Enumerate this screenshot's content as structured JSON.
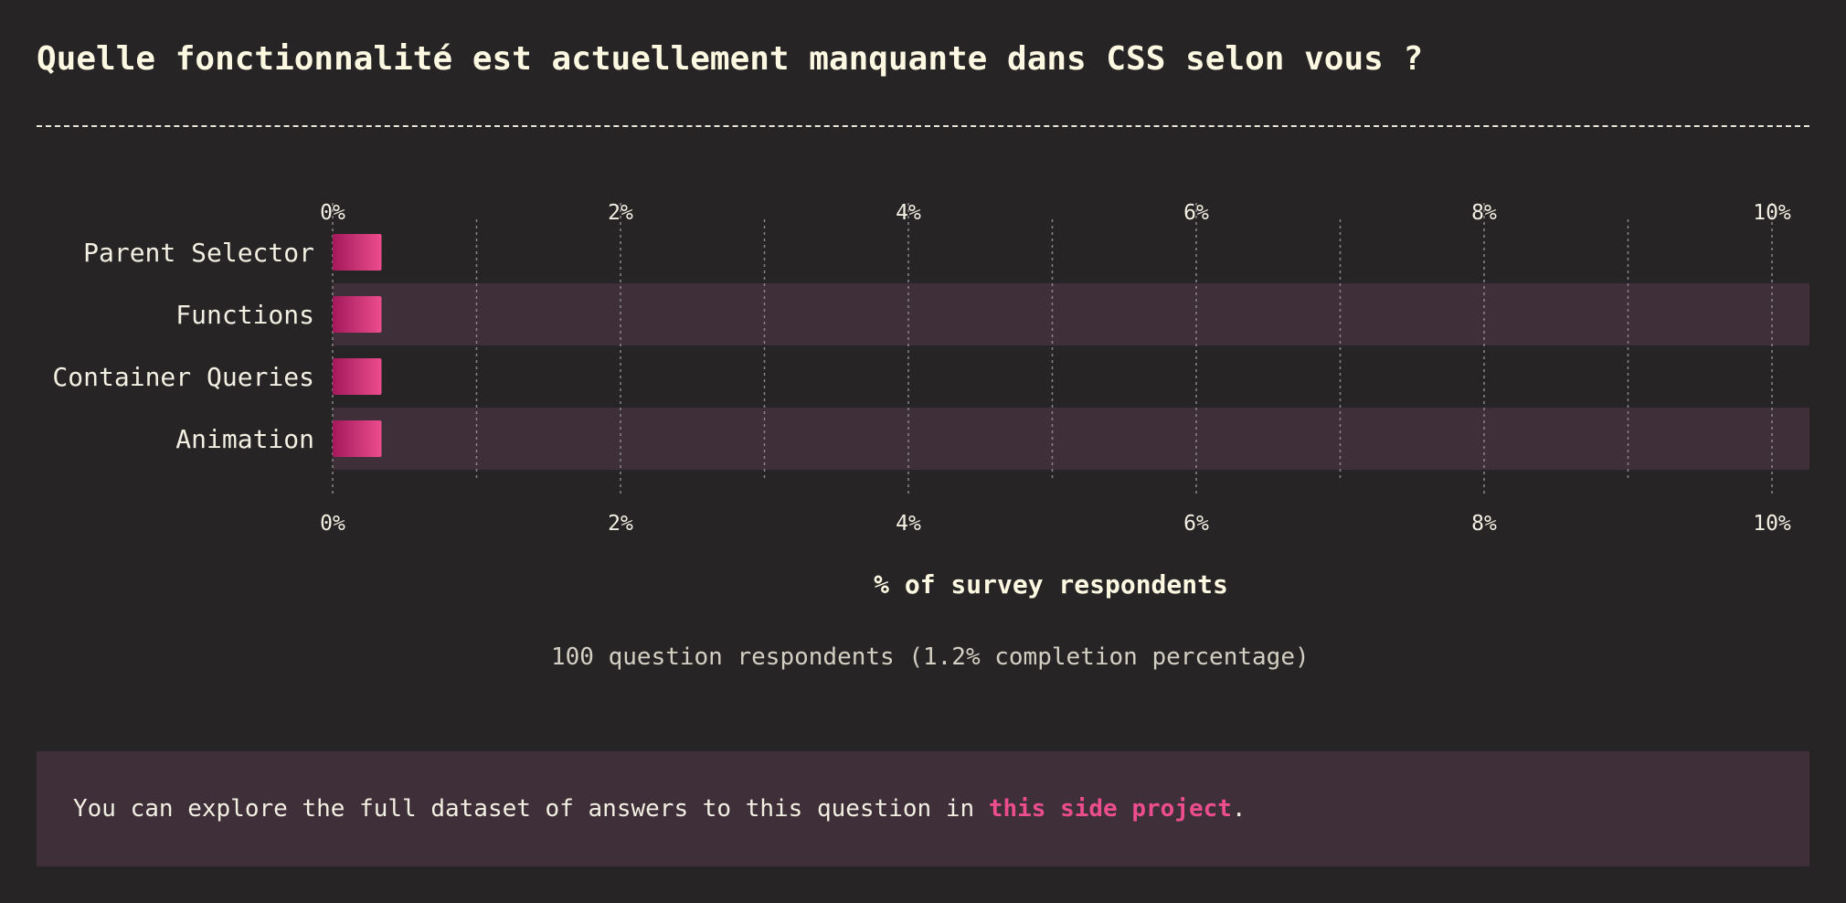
{
  "page": {
    "title": "Quelle fonctionnalité est actuellement manquante dans CSS selon vous ?"
  },
  "chart_data": {
    "type": "bar",
    "orientation": "horizontal",
    "categories": [
      "Parent Selector",
      "Functions",
      "Container Queries",
      "Animation"
    ],
    "values": [
      0.2,
      0.2,
      0.2,
      0.2
    ],
    "xlim": [
      0,
      10
    ],
    "xticks": [
      "0%",
      "2%",
      "4%",
      "6%",
      "8%",
      "10%"
    ],
    "xlabel": "% of survey respondents",
    "grid": true,
    "bar_color_start": "#a3195b",
    "bar_color_end": "#ec4d8d"
  },
  "footer": {
    "respondents": "100 question respondents (1.2% completion percentage)",
    "note_prefix": "You can explore the full dataset of answers to this question in ",
    "note_link": "this side project",
    "note_suffix": "."
  },
  "colors": {
    "background": "#272426",
    "stripe": "#3f2f39",
    "accent": "#ec4d8d",
    "title": "#fcf8e2"
  }
}
